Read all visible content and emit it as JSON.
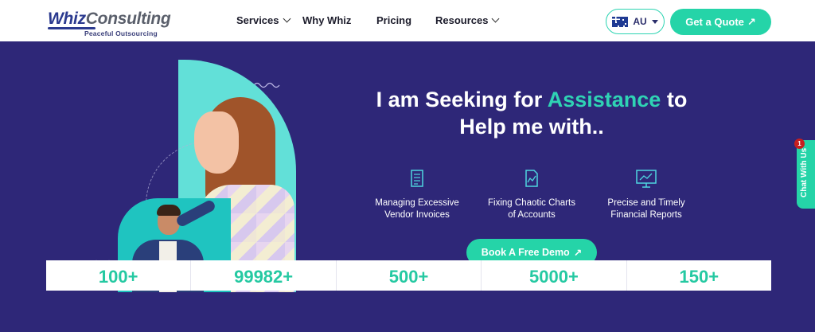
{
  "header": {
    "logo": {
      "brand_whiz": "Whiz",
      "brand_consulting": "Consulting",
      "tagline": "Peaceful Outsourcing"
    },
    "nav": [
      {
        "label": "Services",
        "has_dropdown": true
      },
      {
        "label": "Why Whiz",
        "has_dropdown": false
      },
      {
        "label": "Pricing",
        "has_dropdown": false
      },
      {
        "label": "Resources",
        "has_dropdown": true
      }
    ],
    "region": {
      "label": "AU",
      "flag_icon": "australia-flag-icon"
    },
    "quote_button": "Get a Quote",
    "quote_arrow": "↗"
  },
  "hero": {
    "title_part1": "I am Seeking for",
    "title_accent": "Assistance",
    "title_part2": "to",
    "title_line2": "Help me with..",
    "features": [
      {
        "line1": "Managing Excessive",
        "line2": "Vendor Invoices",
        "icon": "invoice-icon"
      },
      {
        "line1": "Fixing Chaotic Charts",
        "line2": "of Accounts",
        "icon": "chart-document-icon"
      },
      {
        "line1": "Precise and Timely",
        "line2": "Financial Reports",
        "icon": "report-board-icon"
      }
    ],
    "demo_button": "Book A Free Demo",
    "demo_arrow": "↗"
  },
  "chat": {
    "label": "Chat With Us",
    "badge": "1"
  },
  "stats": [
    {
      "value": "100+"
    },
    {
      "value": "99982+"
    },
    {
      "value": "500+"
    },
    {
      "value": "5000+"
    },
    {
      "value": "150+"
    }
  ],
  "colors": {
    "hero_bg": "#2e2778",
    "accent": "#25d4a8",
    "arch": "#62e0d8"
  }
}
